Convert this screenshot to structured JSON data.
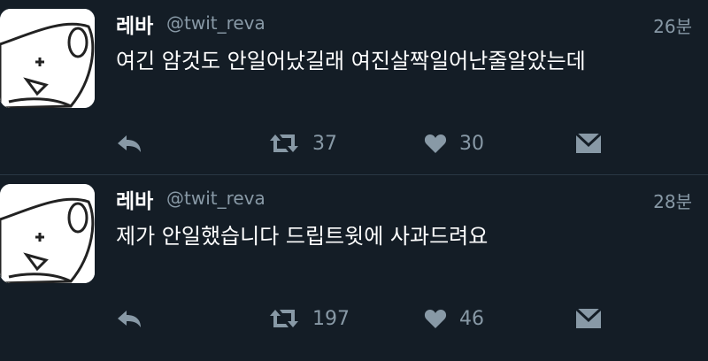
{
  "tweets": [
    {
      "name": "레바",
      "handle": "@twit_reva",
      "time": "26분",
      "text": "여긴 암것도 안일어났길래 여진살짝일어난줄알았는데",
      "retweets": "37",
      "likes": "30"
    },
    {
      "name": "레바",
      "handle": "@twit_reva",
      "time": "28분",
      "text": "제가 안일했습니다 드립트윗에 사과드려요",
      "retweets": "197",
      "likes": "46"
    }
  ],
  "colors": {
    "background": "#141d26",
    "secondary_text": "#8899a6",
    "divider": "#2a3744"
  },
  "icons": [
    "reply-icon",
    "retweet-icon",
    "like-icon",
    "direct-message-icon"
  ]
}
